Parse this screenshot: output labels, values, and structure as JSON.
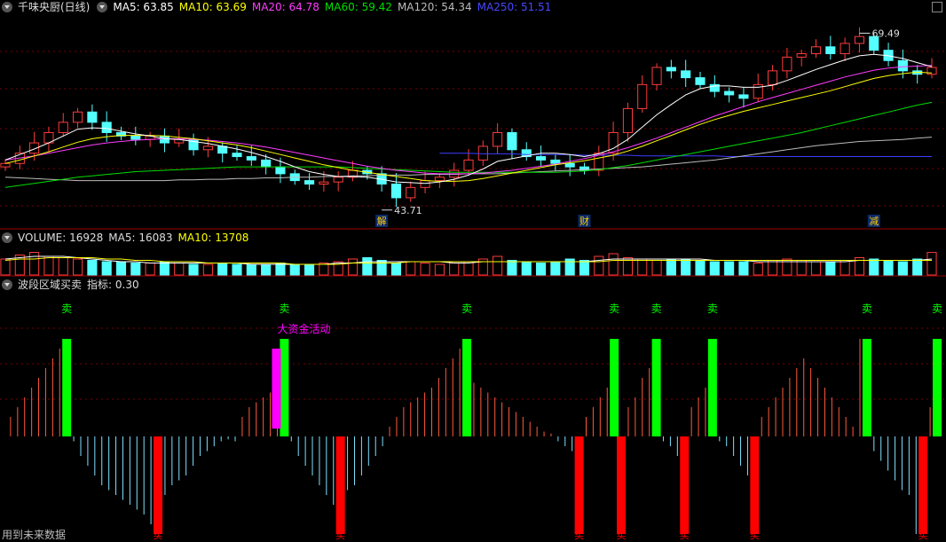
{
  "main_header": {
    "stock": "千味央厨(日线)",
    "ma5": "MA5: 63.85",
    "ma10": "MA10: 63.69",
    "ma20": "MA20: 64.78",
    "ma60": "MA60: 59.42",
    "ma120": "MA120: 54.34",
    "ma250": "MA250: 51.51"
  },
  "volume_header": {
    "volume": "VOLUME: 16928",
    "ma5": "MA5: 16083",
    "ma10": "MA10: 13708"
  },
  "indicator_header": {
    "name": "波段区域买卖",
    "value": "指标: 0.30"
  },
  "footer": "用到未来数据",
  "colors": {
    "up": "#ff3b3b",
    "down": "#54ffff",
    "ma5": "#ffffff",
    "ma10": "#ffff00",
    "ma20": "#ff3cff",
    "ma60": "#00dd00",
    "ma120": "#bbbbbb",
    "ma250": "#3c3cff",
    "sell": "#00ff00",
    "buy": "#ff0000",
    "bigfund": "#ff00ff",
    "grid": "#7a0000"
  },
  "chart_data": [
    {
      "type": "candlestick",
      "title": "千味央厨(日线)",
      "ylim": [
        42,
        72
      ],
      "annotations": [
        {
          "text": "69.49",
          "bar": 59,
          "value": 69.49
        },
        {
          "text": "43.71",
          "bar": 26,
          "value": 43.71
        }
      ],
      "event_markers": [
        {
          "text": "解",
          "bar": 26
        },
        {
          "text": "财",
          "bar": 40
        },
        {
          "text": "减",
          "bar": 60
        }
      ],
      "close": [
        50.5,
        52.0,
        53.5,
        55.0,
        56.5,
        58.0,
        56.5,
        55.0,
        54.5,
        54.0,
        54.5,
        53.5,
        54.0,
        52.5,
        53.0,
        52.0,
        51.5,
        51.0,
        50.0,
        49.0,
        48.0,
        47.5,
        47.8,
        48.5,
        49.5,
        49.0,
        47.5,
        45.5,
        47.0,
        48.0,
        48.5,
        49.5,
        51.0,
        53.0,
        55.0,
        52.5,
        51.5,
        51.0,
        50.5,
        50.0,
        49.5,
        52.0,
        55.0,
        58.5,
        62.0,
        64.5,
        64.0,
        63.0,
        62.0,
        61.0,
        60.5,
        60.0,
        62.0,
        64.0,
        66.0,
        66.5,
        67.5,
        66.5,
        68.0,
        69.0,
        67.0,
        65.5,
        64.0,
        63.5,
        64.5
      ],
      "ma5": [
        51.0,
        51.8,
        52.6,
        53.5,
        54.5,
        55.5,
        55.7,
        55.6,
        55.2,
        54.8,
        54.5,
        54.1,
        54.0,
        53.7,
        53.4,
        53.0,
        52.6,
        52.1,
        51.5,
        50.8,
        50.0,
        49.3,
        48.9,
        48.6,
        48.6,
        48.5,
        48.2,
        47.8,
        47.7,
        47.6,
        47.8,
        48.2,
        48.8,
        49.7,
        50.8,
        51.2,
        51.6,
        52.0,
        52.0,
        51.8,
        51.5,
        51.9,
        52.7,
        54.0,
        55.8,
        57.6,
        59.1,
        60.5,
        61.4,
        61.8,
        61.8,
        61.6,
        61.6,
        61.9,
        62.6,
        63.4,
        64.2,
        64.9,
        65.6,
        66.2,
        66.4,
        66.2,
        65.8,
        65.2,
        64.6
      ],
      "ma10": [
        50.5,
        51.0,
        51.6,
        52.2,
        52.9,
        53.6,
        54.1,
        54.4,
        54.6,
        54.6,
        54.6,
        54.5,
        54.3,
        54.1,
        53.8,
        53.5,
        53.2,
        52.8,
        52.3,
        51.8,
        51.3,
        50.8,
        50.3,
        49.9,
        49.5,
        49.2,
        48.9,
        48.6,
        48.3,
        48.0,
        47.9,
        47.9,
        48.0,
        48.3,
        48.7,
        49.1,
        49.5,
        49.9,
        50.3,
        50.6,
        50.9,
        51.3,
        51.7,
        52.3,
        53.0,
        53.8,
        54.6,
        55.4,
        56.2,
        56.9,
        57.5,
        58.1,
        58.6,
        59.1,
        59.6,
        60.1,
        60.6,
        61.1,
        61.7,
        62.3,
        62.9,
        63.3,
        63.6,
        63.8,
        63.7
      ],
      "ma20": [
        51.0,
        51.3,
        51.6,
        52.0,
        52.4,
        52.8,
        53.2,
        53.5,
        53.7,
        53.9,
        54.0,
        54.1,
        54.1,
        54.0,
        53.9,
        53.7,
        53.5,
        53.2,
        52.9,
        52.5,
        52.1,
        51.7,
        51.3,
        50.9,
        50.5,
        50.1,
        49.8,
        49.5,
        49.3,
        49.1,
        49.0,
        49.0,
        49.0,
        49.1,
        49.3,
        49.5,
        49.8,
        50.1,
        50.4,
        50.8,
        51.2,
        51.7,
        52.2,
        52.8,
        53.5,
        54.2,
        55.0,
        55.8,
        56.6,
        57.4,
        58.1,
        58.8,
        59.5,
        60.1,
        60.7,
        61.3,
        61.9,
        62.5,
        63.1,
        63.6,
        64.1,
        64.4,
        64.6,
        64.7,
        64.8
      ],
      "ma60": [
        47.0,
        47.3,
        47.6,
        47.9,
        48.2,
        48.5,
        48.7,
        48.9,
        49.1,
        49.3,
        49.4,
        49.5,
        49.6,
        49.7,
        49.8,
        49.9,
        50.0,
        50.0,
        50.0,
        50.0,
        50.0,
        50.0,
        50.0,
        50.0,
        49.9,
        49.8,
        49.7,
        49.6,
        49.5,
        49.4,
        49.3,
        49.2,
        49.2,
        49.2,
        49.2,
        49.2,
        49.2,
        49.2,
        49.2,
        49.3,
        49.4,
        49.6,
        49.9,
        50.2,
        50.6,
        51.0,
        51.4,
        51.8,
        52.2,
        52.6,
        53.0,
        53.4,
        53.8,
        54.2,
        54.6,
        55.0,
        55.5,
        56.0,
        56.5,
        57.0,
        57.5,
        58.0,
        58.5,
        59.0,
        59.4
      ],
      "ma120": [
        48.5,
        48.4,
        48.3,
        48.2,
        48.1,
        48.0,
        48.0,
        48.0,
        48.0,
        48.0,
        48.0,
        48.0,
        48.1,
        48.1,
        48.2,
        48.2,
        48.3,
        48.3,
        48.4,
        48.4,
        48.5,
        48.5,
        48.6,
        48.6,
        48.7,
        48.7,
        48.8,
        48.8,
        48.8,
        48.9,
        48.9,
        48.9,
        49.0,
        49.0,
        49.0,
        49.1,
        49.2,
        49.3,
        49.4,
        49.5,
        49.6,
        49.7,
        49.8,
        49.9,
        50.0,
        50.2,
        50.4,
        50.6,
        50.8,
        51.0,
        51.3,
        51.6,
        51.9,
        52.2,
        52.5,
        52.8,
        53.1,
        53.3,
        53.5,
        53.7,
        53.8,
        53.9,
        54.0,
        54.2,
        54.34
      ],
      "ma250_start_bar": 30,
      "ma250": [
        52.0,
        52.0,
        52.0,
        51.9,
        51.9,
        51.9,
        51.8,
        51.8,
        51.8,
        51.8,
        51.7,
        51.7,
        51.7,
        51.7,
        51.6,
        51.6,
        51.6,
        51.6,
        51.6,
        51.6,
        51.5,
        51.5,
        51.5,
        51.5,
        51.5,
        51.5,
        51.5,
        51.5,
        51.5,
        51.5,
        51.5,
        51.5,
        51.5,
        51.5,
        51.51
      ]
    },
    {
      "type": "bar",
      "title": "VOLUME",
      "values": [
        12,
        15,
        17,
        14,
        13,
        12,
        11,
        10,
        10,
        9,
        9,
        10,
        9,
        8,
        8,
        9,
        8,
        8,
        8,
        9,
        8,
        8,
        9,
        10,
        12,
        13,
        11,
        9,
        10,
        9,
        8,
        9,
        10,
        12,
        14,
        11,
        10,
        9,
        10,
        12,
        11,
        14,
        16,
        13,
        12,
        11,
        12,
        12,
        11,
        10,
        10,
        10,
        9,
        11,
        12,
        11,
        10,
        10,
        11,
        13,
        12,
        11,
        10,
        12,
        16.928
      ],
      "ma5": [
        12,
        13,
        14,
        14,
        14,
        13,
        12,
        11,
        10,
        10,
        9,
        9,
        9,
        9,
        9,
        9,
        9,
        8,
        8,
        8,
        8,
        8,
        8,
        9,
        9,
        10,
        10,
        10,
        10,
        10,
        10,
        9,
        9,
        10,
        10,
        10,
        10,
        10,
        10,
        10,
        10,
        11,
        12,
        12,
        12,
        12,
        12,
        12,
        12,
        11,
        11,
        11,
        10,
        10,
        10,
        10,
        10,
        10,
        10,
        11,
        11,
        11,
        11,
        11,
        12
      ],
      "ma10": [
        11,
        12,
        12,
        13,
        13,
        13,
        13,
        12,
        12,
        11,
        11,
        10,
        10,
        10,
        9,
        9,
        9,
        9,
        9,
        9,
        8,
        8,
        8,
        8,
        9,
        9,
        9,
        9,
        10,
        10,
        10,
        10,
        10,
        10,
        10,
        10,
        10,
        10,
        10,
        10,
        10,
        10,
        11,
        11,
        11,
        11,
        11,
        11,
        11,
        11,
        11,
        11,
        11,
        11,
        11,
        11,
        11,
        11,
        11,
        11,
        11,
        11,
        11,
        11,
        11
      ]
    },
    {
      "type": "bar",
      "title": "波段区域买卖",
      "ylim": [
        -1,
        1
      ],
      "values": [
        0.0,
        0.2,
        0.3,
        0.4,
        0.5,
        0.6,
        0.7,
        0.8,
        0.9,
        1.0,
        -0.05,
        -0.2,
        -0.3,
        -0.4,
        -0.5,
        -0.55,
        -0.6,
        -0.65,
        -0.7,
        -0.75,
        -0.8,
        -0.9,
        -1.0,
        -0.6,
        -0.5,
        -0.45,
        -0.4,
        -0.3,
        -0.2,
        -0.15,
        -0.1,
        -0.05,
        -0.03,
        -0.05,
        0.2,
        0.3,
        0.35,
        0.4,
        0.45,
        0.5,
        1.0,
        -0.05,
        -0.2,
        -0.3,
        -0.4,
        -0.5,
        -0.6,
        -0.7,
        -1.0,
        -0.55,
        -0.5,
        -0.4,
        -0.3,
        -0.2,
        -0.1,
        0.1,
        0.2,
        0.3,
        0.35,
        0.4,
        0.45,
        0.5,
        0.6,
        0.7,
        0.8,
        0.9,
        1.0,
        0.55,
        0.5,
        0.45,
        0.4,
        0.35,
        0.3,
        0.25,
        0.2,
        0.15,
        0.1,
        0.05,
        0.03,
        -0.05,
        -0.1,
        -0.15,
        -1.0,
        0.2,
        0.3,
        0.4,
        0.5,
        1.0,
        -1.0,
        0.3,
        0.4,
        0.6,
        0.7,
        1.0,
        -0.05,
        -0.1,
        -0.2,
        -1.0,
        0.3,
        0.4,
        0.5,
        1.0,
        -0.05,
        -0.1,
        -0.2,
        -0.3,
        -0.4,
        -1.0,
        0.2,
        0.3,
        0.4,
        0.5,
        0.6,
        0.7,
        0.8,
        0.7,
        0.6,
        0.5,
        0.4,
        0.3,
        0.2,
        0.1,
        1.0,
        -0.05,
        -0.15,
        -0.25,
        -0.35,
        -0.45,
        -0.55,
        -0.6,
        -1.0,
        -0.3,
        0.3,
        1.0
      ],
      "sell_signals": [
        {
          "text": "卖",
          "bar": 9
        },
        {
          "text": "卖",
          "bar": 40
        },
        {
          "text": "卖",
          "bar": 66
        },
        {
          "text": "卖",
          "bar": 87
        },
        {
          "text": "卖",
          "bar": 93
        },
        {
          "text": "卖",
          "bar": 101
        },
        {
          "text": "卖",
          "bar": 123
        },
        {
          "text": "卖",
          "bar": 133
        }
      ],
      "buy_signals": [
        {
          "text": "买",
          "bar": 22
        },
        {
          "text": "买",
          "bar": 48
        },
        {
          "text": "买",
          "bar": 82
        },
        {
          "text": "买",
          "bar": 88
        },
        {
          "text": "买",
          "bar": 97
        },
        {
          "text": "买",
          "bar": 107
        },
        {
          "text": "买",
          "bar": 131
        }
      ],
      "big_fund": {
        "text": "大资金活动",
        "bar": 39,
        "value": 0.9
      }
    }
  ]
}
